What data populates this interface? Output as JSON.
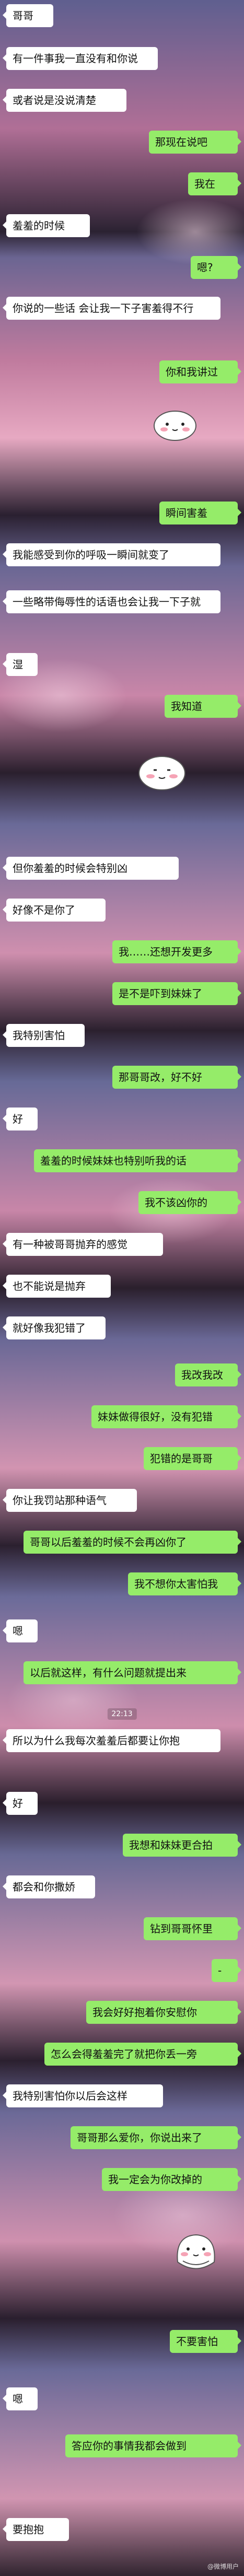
{
  "messages": [
    {
      "side": "left",
      "text": "哥哥"
    },
    {
      "side": "left",
      "text": "有一件事我一直没有和你说"
    },
    {
      "side": "left",
      "text": "或者说是没说清楚"
    },
    {
      "side": "right",
      "text": "那现在说吧"
    },
    {
      "side": "right",
      "text": "我在"
    },
    {
      "side": "left",
      "text": "羞羞的时候"
    },
    {
      "side": "right",
      "text": "嗯?"
    },
    {
      "side": "left",
      "text": "你说的一些话 会让我一下子害羞得不行"
    },
    {
      "side": "right",
      "text": "你和我讲过"
    },
    {
      "side": "right",
      "text": "瞬间害羞"
    },
    {
      "side": "left",
      "text": "我能感受到你的呼吸一瞬间就变了"
    },
    {
      "side": "left",
      "text": "一些略带侮辱性的话语也会让我一下子就"
    },
    {
      "side": "left",
      "text": "湿"
    },
    {
      "side": "right",
      "text": "我知道"
    },
    {
      "side": "left",
      "text": "但你羞羞的时候会特别凶"
    },
    {
      "side": "left",
      "text": "好像不是你了"
    },
    {
      "side": "right",
      "text": "我……还想开发更多"
    },
    {
      "side": "right",
      "text": "是不是吓到妹妹了"
    },
    {
      "side": "left",
      "text": "我特别害怕"
    },
    {
      "side": "right",
      "text": "那哥哥改，好不好"
    },
    {
      "side": "left",
      "text": "好"
    },
    {
      "side": "right",
      "text": "羞羞的时候妹妹也特别听我的话"
    },
    {
      "side": "right",
      "text": "我不该凶你的"
    },
    {
      "side": "left",
      "text": "有一种被哥哥抛弃的感觉"
    },
    {
      "side": "left",
      "text": "也不能说是抛弃"
    },
    {
      "side": "left",
      "text": "就好像我犯错了"
    },
    {
      "side": "right",
      "text": "我改我改"
    },
    {
      "side": "right",
      "text": "妹妹做得很好，没有犯错"
    },
    {
      "side": "right",
      "text": "犯错的是哥哥"
    },
    {
      "side": "left",
      "text": "你让我罚站那种语气"
    },
    {
      "side": "right",
      "text": "哥哥以后羞羞的时候不会再凶你了"
    },
    {
      "side": "right",
      "text": "我不想你太害怕我"
    },
    {
      "side": "left",
      "text": "嗯"
    },
    {
      "side": "right",
      "text": "以后就这样，有什么问题就提出来"
    },
    {
      "side": "time",
      "text": "22:13"
    },
    {
      "side": "left",
      "text": "所以为什么我每次羞羞后都要让你抱"
    },
    {
      "side": "left",
      "text": "好"
    },
    {
      "side": "right",
      "text": "我想和妹妹更合拍"
    },
    {
      "side": "left",
      "text": "都会和你撒娇"
    },
    {
      "side": "right",
      "text": "钻到哥哥怀里"
    },
    {
      "side": "right",
      "text": "-"
    },
    {
      "side": "right",
      "text": "我会好好抱着你安慰你"
    },
    {
      "side": "right",
      "text": "怎么会得羞羞完了就把你丢一旁"
    },
    {
      "side": "left",
      "text": "我特别害怕你以后会这样"
    },
    {
      "side": "right",
      "text": "哥哥那么爱你，你说出来了"
    },
    {
      "side": "right",
      "text": "我一定会为你改掉的"
    },
    {
      "side": "right",
      "text": "不要害怕"
    },
    {
      "side": "left",
      "text": "嗯"
    },
    {
      "side": "right",
      "text": "答应你的事情我都会做到"
    },
    {
      "side": "left",
      "text": "要抱抱"
    }
  ],
  "watermark": "@微博用户"
}
